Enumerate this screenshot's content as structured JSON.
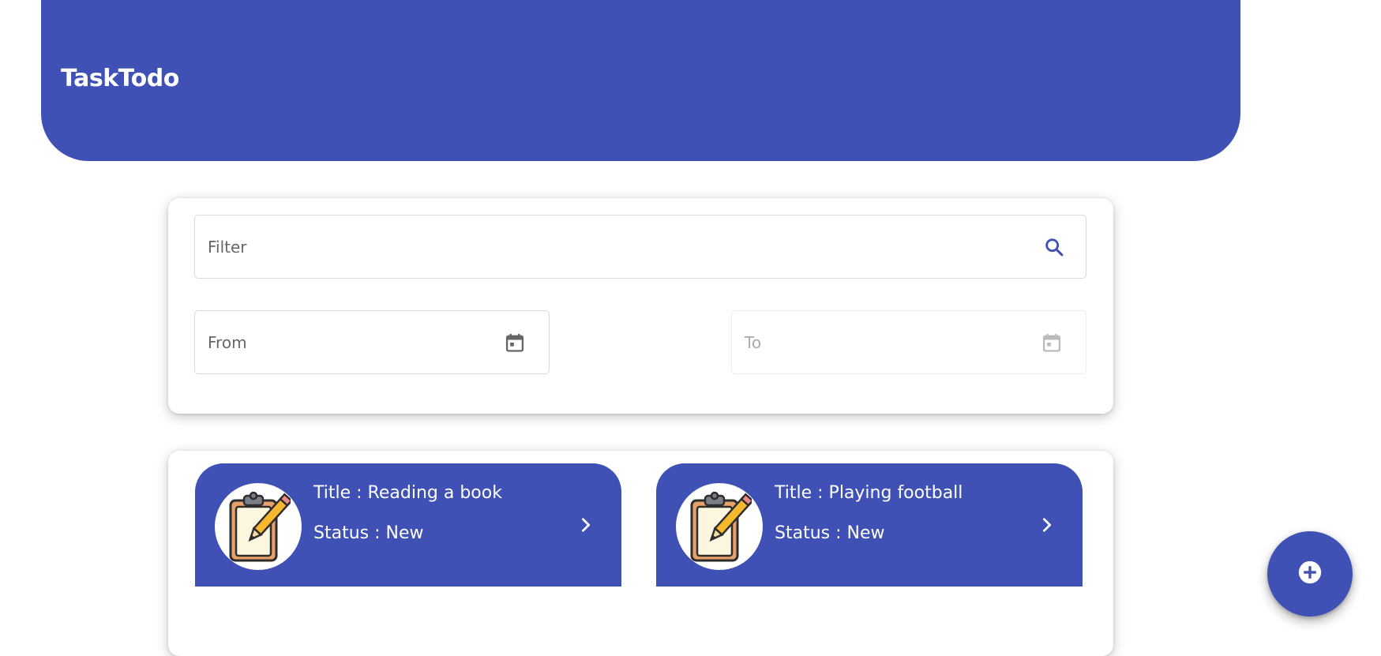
{
  "header": {
    "title": "TaskTodo",
    "color": "#3f51b5"
  },
  "filters": {
    "filter": {
      "placeholder": "Filter",
      "value": "",
      "icon": "search-icon"
    },
    "from": {
      "placeholder": "From",
      "value": "",
      "icon": "calendar-icon",
      "enabled": true
    },
    "to": {
      "placeholder": "To",
      "value": "",
      "icon": "calendar-icon",
      "enabled": false
    }
  },
  "tasks": [
    {
      "title": "Title : Reading a book",
      "status": "Status : New",
      "icon": "clipboard-pencil-icon"
    },
    {
      "title": "Title : Playing football",
      "status": "Status : New",
      "icon": "clipboard-pencil-icon"
    }
  ],
  "fab": {
    "icon": "add-circle-icon"
  },
  "colors": {
    "primary": "#3f51b5",
    "surface": "#ffffff"
  }
}
